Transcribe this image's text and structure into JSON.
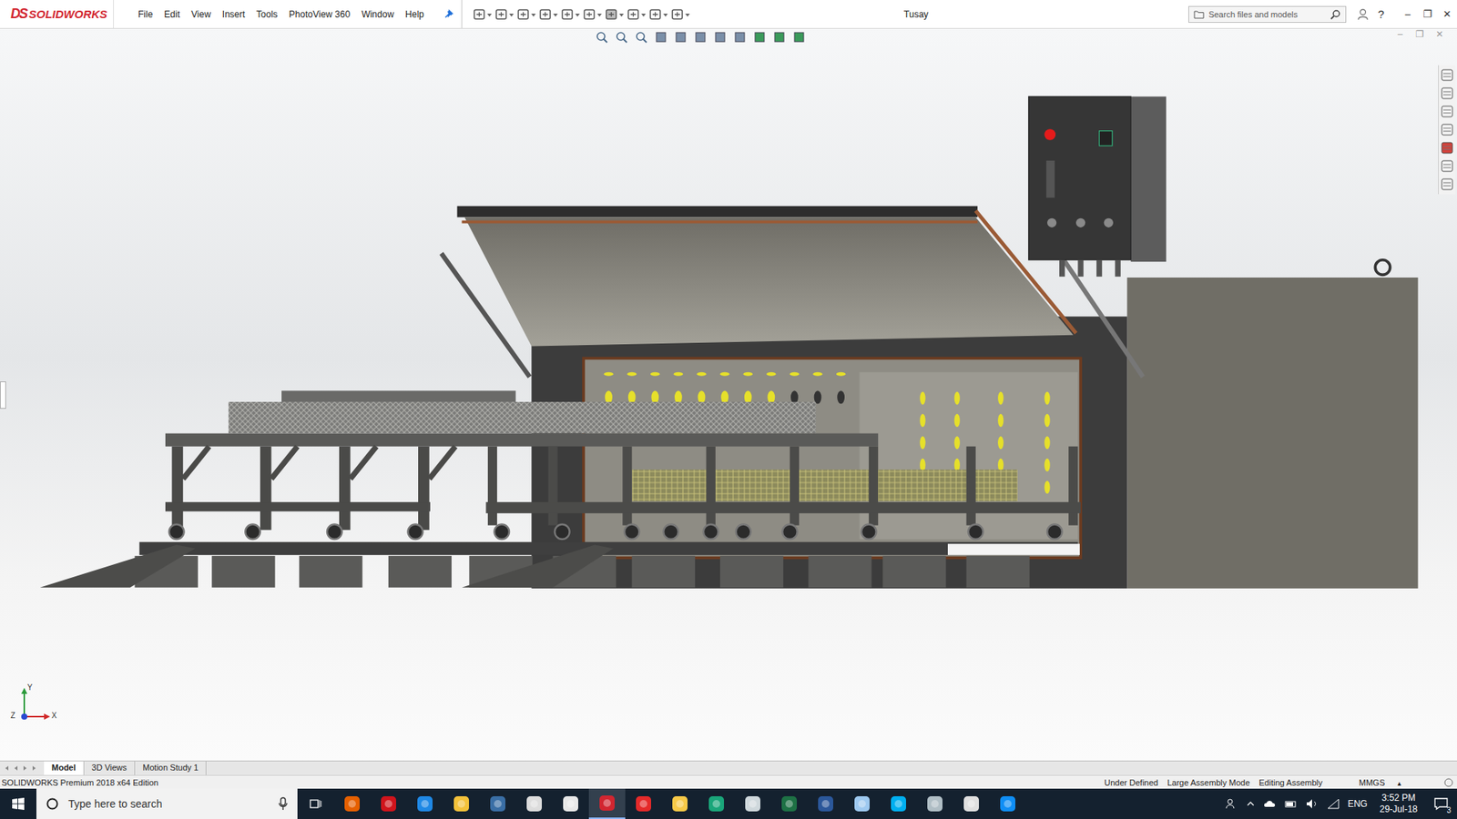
{
  "app": {
    "logo_mark": "DS",
    "logo": "SOLIDWORKS"
  },
  "window": {
    "title": "Tusay",
    "controls": [
      "–",
      "❐",
      "✕"
    ]
  },
  "menu": [
    "File",
    "Edit",
    "View",
    "Insert",
    "Tools",
    "PhotoView 360",
    "Window",
    "Help"
  ],
  "search": {
    "placeholder": "Search files and models"
  },
  "help": "?",
  "viewport_controls": [
    "–",
    "❐",
    "✕"
  ],
  "triad": {
    "axes": [
      "Y",
      "Z",
      "X"
    ]
  },
  "tabs": [
    {
      "label": "Model",
      "selected": true
    },
    {
      "label": "3D Views",
      "selected": false
    },
    {
      "label": "Motion Study 1",
      "selected": false
    }
  ],
  "status_bar": {
    "edition": "SOLIDWORKS Premium 2018 x64 Edition",
    "items": [
      "Under Defined",
      "Large Assembly Mode",
      "Editing Assembly"
    ],
    "units": "MMGS",
    "units_arrow": "▲"
  },
  "taskbar": {
    "search_placeholder": "Type here to search",
    "language": "ENG",
    "time": "3:52 PM",
    "date": "29-Jul-18",
    "notifications": "3"
  }
}
